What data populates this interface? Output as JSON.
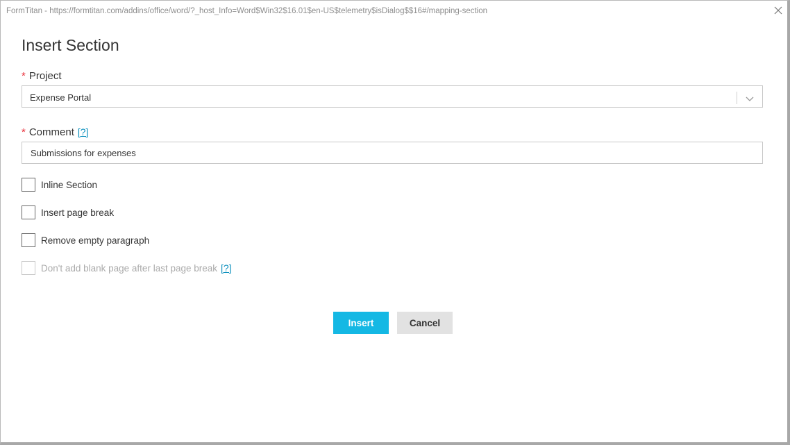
{
  "window": {
    "title": "FormTitan - https://formtitan.com/addins/office/word/?_host_Info=Word$Win32$16.01$en-US$telemetry$isDialog$$16#/mapping-section",
    "close_icon": "close-icon"
  },
  "dialog": {
    "title": "Insert Section"
  },
  "project": {
    "required_marker": "*",
    "label": "Project",
    "selected_value": "Expense Portal",
    "dropdown_icon": "chevron-down-icon"
  },
  "comment": {
    "required_marker": "*",
    "label": "Comment",
    "help": "[?]",
    "value": "Submissions for expenses"
  },
  "options": [
    {
      "label": "Inline Section",
      "checked": false,
      "disabled": false
    },
    {
      "label": "Insert page break",
      "checked": false,
      "disabled": false
    },
    {
      "label": "Remove empty paragraph",
      "checked": false,
      "disabled": false
    },
    {
      "label": "Don't add blank page after last page break",
      "checked": false,
      "disabled": true,
      "help": "[?]"
    }
  ],
  "buttons": {
    "insert": "Insert",
    "cancel": "Cancel"
  },
  "colors": {
    "primary_button": "#14b8e4",
    "secondary_button": "#e2e2e2",
    "required": "#e8323c",
    "link": "#0b8fbd"
  }
}
